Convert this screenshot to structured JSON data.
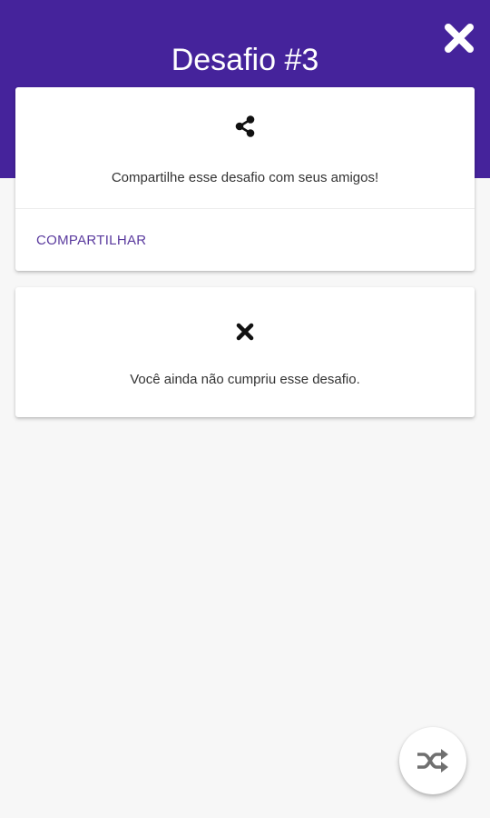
{
  "header": {
    "title": "Desafio #3",
    "close_icon": "close-icon",
    "background_color": "#45239b"
  },
  "share_card": {
    "icon": "share-icon",
    "text": "Compartilhe esse desafio com seus amigos!",
    "action_label": "COMPARTILHAR",
    "action_color": "#5a3a9e"
  },
  "status_card": {
    "icon": "x-icon",
    "text": "Você ainda não cumpriu esse desafio."
  },
  "fab": {
    "icon": "shuffle-icon"
  }
}
